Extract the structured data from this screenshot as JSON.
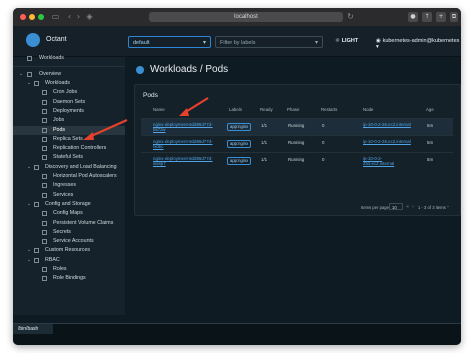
{
  "browser": {
    "url": "localhost",
    "traffic_lights": [
      "#fe5f57",
      "#febc2e",
      "#28c840"
    ]
  },
  "header": {
    "brand": "Octant",
    "namespace": "default",
    "filter_placeholder": "Filter by labels",
    "theme_toggle": "LIGHT",
    "context": "kubernetes-admin@kubernetes"
  },
  "sidebar": {
    "workloads_top": "Workloads",
    "overview": "Overview",
    "sections": [
      {
        "label": "Workloads",
        "items": [
          "Cron Jobs",
          "Daemon Sets",
          "Deployments",
          "Jobs",
          "Pods",
          "Replica Sets",
          "Replication Controllers",
          "Stateful Sets"
        ]
      },
      {
        "label": "Discovery and Load Balancing",
        "items": [
          "Horizontal Pod Autoscalers",
          "Ingresses",
          "Services"
        ]
      },
      {
        "label": "Config and Storage",
        "items": [
          "Config Maps",
          "Persistent Volume Claims",
          "Secrets",
          "Service Accounts"
        ]
      },
      {
        "label": "Custom Resources",
        "items": []
      },
      {
        "label": "RBAC",
        "items": [
          "Roles",
          "Role Bindings"
        ]
      }
    ],
    "active_item": "Pods"
  },
  "main": {
    "title": "Workloads / Pods",
    "card_title": "Pods",
    "columns": [
      "Name",
      "Labels",
      "Ready",
      "Phase",
      "Restarts",
      "Node",
      "Age"
    ],
    "rows": [
      {
        "name1": "nginx-deployment-6dd86d77d-",
        "name2": "bk7zw",
        "label": "app:nginx",
        "ready": "1/1",
        "phase": "Running",
        "restarts": "0",
        "node": "ip-10-0-2-26.ec2.internal",
        "node2": "",
        "age": "5m"
      },
      {
        "name1": "nginx-deployment-6dd86d77d-fxdbc",
        "name2": "",
        "label": "app:nginx",
        "ready": "1/1",
        "phase": "Running",
        "restarts": "0",
        "node": "ip-10-0-2-26.ec2.internal",
        "node2": "",
        "age": "5m"
      },
      {
        "name1": "nginx-deployment-6dd86d77d-",
        "name2": "ws8p7",
        "label": "app:nginx",
        "ready": "1/1",
        "phase": "Running",
        "restarts": "0",
        "node": "ip-10-0-2-",
        "node2": "253.ec2.internal",
        "age": "5m"
      }
    ],
    "pager_label": "Items per page:",
    "page_size": "10",
    "page_range": "1 - 3 of 3 items"
  },
  "terminal": {
    "tab": "/bin/bash"
  },
  "annotation_color": "#e5412d"
}
